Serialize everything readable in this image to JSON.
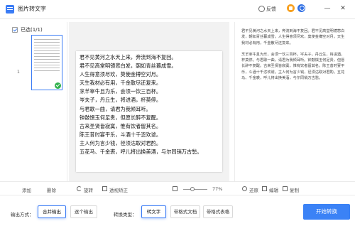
{
  "window": {
    "title": "图片转文字",
    "feedback": "反馈",
    "minimize": "—",
    "close": "✕"
  },
  "thumbs": {
    "selected_label": "已选(1/1)",
    "index": "1",
    "add_label": "添加",
    "delete_label": "删除"
  },
  "preview": {
    "lines": [
      "君不见黄河之水天上来，奔流到海不复回。",
      "君不见高堂明镜悲白发，朝如青丝暮成雪。",
      "人生得意须尽欢，莫使金樽空对月。",
      "天生我材必有用，千金散尽还复来。",
      "烹羊宰牛且为乐，会须一饮三百杯。",
      "岑夫子，丹丘生，将进酒，杯莫停。",
      "与君歌一曲，请君为我倾耳听。",
      "钟鼓馔玉何足贵，但愿长醉不复醒。",
      "古来圣贤皆寂寞，惟有饮者留其名。",
      "陈王昔时宴平乐，斗酒十千恣欢谑。",
      "主人何为言少钱，径须沽取对君酌。",
      "五花马、千金裘，呼儿将出换美酒，与尔同销万古愁。"
    ],
    "rotate_label": "旋转",
    "perspective_label": "透视矫正",
    "zoom": "77%"
  },
  "result": {
    "paragraphs": [
      "君不见黄河之水天上来，奔流到海不复回。君不见高堂明镜悲白发，朝如青丝暮成雪。人生得意须尽欢，莫使金樽空对月。天生我材必有用，千金散尽还复来。",
      "烹羊宰牛且为乐，会须一饮三百杯。岑夫子，丹丘生，将进酒，杯莫停。与君歌一曲，请君为我倾耳听。钟鼓馔玉何足贵，但愿长醉不复醒。古来圣贤皆寂寞，惟有饮者留其名。陈王昔时宴平乐，斗酒十千恣欢谑。主人何为言少钱，径须沽取对君酌。五花马、千金裘，呼儿将出换美酒，与尔同销万古愁。"
    ],
    "restore_label": "还原",
    "edit_label": "编辑",
    "copy_label": "复制"
  },
  "options": {
    "output_label": "输出方式：",
    "merge_output": "合并输出",
    "each_output": "逐个输出",
    "convert_label": "转换类型：",
    "to_text": "转文字",
    "to_word": "带格式文档",
    "to_excel": "带格式表格",
    "start_button": "开始转换"
  },
  "colors": {
    "accent": "#3b82f6",
    "check": "#33b24f",
    "vip": "#f7a01f"
  }
}
